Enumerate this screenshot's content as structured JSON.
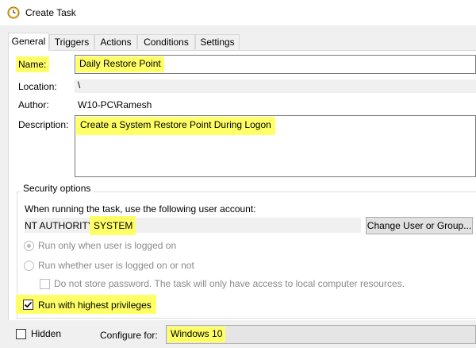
{
  "window": {
    "title": "Create Task",
    "icon": "clock-icon"
  },
  "tabs": [
    {
      "label": "General",
      "active": true
    },
    {
      "label": "Triggers"
    },
    {
      "label": "Actions"
    },
    {
      "label": "Conditions"
    },
    {
      "label": "Settings"
    }
  ],
  "general": {
    "name_label": "Name:",
    "name_value": "Daily Restore Point",
    "location_label": "Location:",
    "location_value": "\\",
    "author_label": "Author:",
    "author_value": "W10-PC\\Ramesh",
    "description_label": "Description:",
    "description_value": "Create a System Restore Point During Logon"
  },
  "security": {
    "legend": "Security options",
    "account_prompt": "When running the task, use the following user account:",
    "account_prefix": "NT AUTHORITY\\",
    "account_highlight": "SYSTEM",
    "change_button": "Change User or Group...",
    "radio_logged_on": "Run only when user is logged on",
    "radio_logged_on_or_not": "Run whether user is logged on or not",
    "no_store_password": "Do not store password.  The task will only have access to local computer resources.",
    "highest_privileges": "Run with highest privileges"
  },
  "bottom": {
    "hidden_label": "Hidden",
    "configure_label": "Configure for:",
    "configure_value": "Windows 10"
  },
  "colors": {
    "highlight": "#ffff66",
    "panel": "#ffffff",
    "chrome": "#f0f0f0"
  }
}
